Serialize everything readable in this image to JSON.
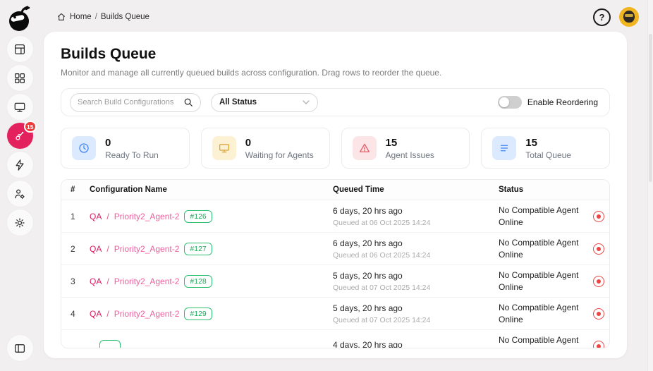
{
  "colors": {
    "page_bg": "#f1efef",
    "accent_pink": "#e3215d",
    "project_link": "#d81b5f",
    "config_link": "#ee5f9d",
    "badge_green": "#2fbf71",
    "stop_red": "#ef4444",
    "stat_blue": "#4285f4",
    "stat_yellow": "#dca43a",
    "stat_rose": "#e35d6a"
  },
  "topbar": {
    "breadcrumb": {
      "home": "Home",
      "separator": "/",
      "current": "Builds Queue"
    },
    "help_glyph": "?"
  },
  "sidebar": {
    "queue_badge": "15"
  },
  "header": {
    "title": "Builds Queue",
    "subtitle": "Monitor and manage all currently queued builds across configuration. Drag rows to reorder the queue."
  },
  "filters": {
    "search_placeholder": "Search Build Configurations",
    "status_value": "All Status",
    "reorder_label": "Enable Reordering",
    "reorder_enabled": false
  },
  "stats": [
    {
      "icon": "clock-icon",
      "value": "0",
      "label": "Ready To Run"
    },
    {
      "icon": "monitor-icon",
      "value": "0",
      "label": "Waiting for Agents"
    },
    {
      "icon": "warning-triangle-icon",
      "value": "15",
      "label": "Agent Issues"
    },
    {
      "icon": "list-icon",
      "value": "15",
      "label": "Total Queue"
    }
  ],
  "table": {
    "columns": [
      "#",
      "Configuration Name",
      "Queued Time",
      "Status"
    ],
    "name_separator": "/",
    "rows": [
      {
        "index": "1",
        "project": "QA",
        "config": "Priority2_Agent-2",
        "build": "#126",
        "time_ago": "6 days, 20 hrs ago",
        "queued_at": "Queued at 06 Oct 2025 14:24",
        "status": "No Compatible Agent Online"
      },
      {
        "index": "2",
        "project": "QA",
        "config": "Priority2_Agent-2",
        "build": "#127",
        "time_ago": "6 days, 20 hrs ago",
        "queued_at": "Queued at 06 Oct 2025 14:24",
        "status": "No Compatible Agent Online"
      },
      {
        "index": "3",
        "project": "QA",
        "config": "Priority2_Agent-2",
        "build": "#128",
        "time_ago": "5 days, 20 hrs ago",
        "queued_at": "Queued at 07 Oct 2025 14:24",
        "status": "No Compatible Agent Online"
      },
      {
        "index": "4",
        "project": "QA",
        "config": "Priority2_Agent-2",
        "build": "#129",
        "time_ago": "5 days, 20 hrs ago",
        "queued_at": "Queued at 07 Oct 2025 14:24",
        "status": "No Compatible Agent Online"
      },
      {
        "index": "",
        "project": "",
        "config": "",
        "build": "",
        "time_ago": "4 days, 20 hrs ago",
        "queued_at": "",
        "status": "No Compatible Agent Online"
      }
    ]
  }
}
